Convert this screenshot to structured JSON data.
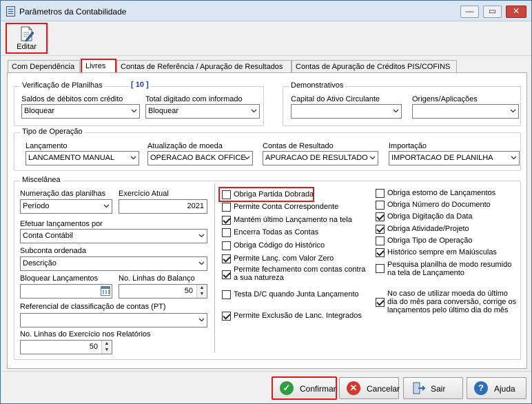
{
  "window": {
    "title": "Parâmetros da Contabilidade",
    "minimize": "—",
    "maximize": "▭",
    "close": "✕"
  },
  "toolbar": {
    "edit_label": "Editar"
  },
  "tabs": [
    "Com Dependência",
    "Livres",
    "Contas de Referência / Apuração de Resultados",
    "Contas de Apuração de Créditos PIS/COFINS"
  ],
  "verificacao": {
    "title": "Verificação de Planilhas",
    "count": "[ 10 ]",
    "saldos_label": "Saldos de débitos com crédito",
    "saldos_value": "Bloquear",
    "total_label": "Total digitado com informado",
    "total_value": "Bloquear"
  },
  "demonstrativos": {
    "title": "Demonstrativos",
    "capital_label": "Capital do Ativo Circulante",
    "capital_value": "",
    "origens_label": "Origens/Aplicações",
    "origens_value": ""
  },
  "tipo_operacao": {
    "title": "Tipo de Operação",
    "lancamento_label": "Lançamento",
    "lancamento_value": "LANCAMENTO MANUAL",
    "atualizacao_label": "Atualização de moeda",
    "atualizacao_value": "OPERACAO BACK OFFICE",
    "contas_label": "Contas de Resultado",
    "contas_value": "APURACAO DE RESULTADO",
    "importacao_label": "Importação",
    "importacao_value": "IMPORTACAO DE PLANILHA"
  },
  "miscelanea": {
    "title": "Miscelânea",
    "numeracao_label": "Numeração das planilhas",
    "numeracao_value": "Período",
    "exercicio_label": "Exercício Atual",
    "exercicio_value": "2021",
    "efetuar_label": "Efetuar lançamentos por",
    "efetuar_value": "Conta Contábil",
    "subconta_label": "Subconta ordenada",
    "subconta_value": "Descrição",
    "bloquear_label": "Bloquear Lançamentos",
    "bloquear_value": "",
    "linhas_balanco_label": "No. Linhas do Balanço",
    "linhas_balanco_value": "50",
    "referencial_label": "Referencial de classificação de contas (PT)",
    "referencial_value": "",
    "linhas_exercicio_label": "No. Linhas do Exercício nos Relatórios",
    "linhas_exercicio_value": "50"
  },
  "checks_mid": [
    {
      "label": "Obriga Partida Dobrada",
      "checked": false
    },
    {
      "label": "Permite Conta Correspondente",
      "checked": false
    },
    {
      "label": "Mantém último Lançamento na tela",
      "checked": true
    },
    {
      "label": "Encerra Todas as Contas",
      "checked": false
    },
    {
      "label": "Obriga Código do Histórico",
      "checked": false
    },
    {
      "label": "Permite Lanç. com Valor Zero",
      "checked": true
    },
    {
      "label": "Permite fechamento com contas contra a sua natureza",
      "checked": true
    },
    {
      "label": "Testa D/C quando Junta Lançamento",
      "checked": false
    },
    {
      "label": "Permite Exclusão de Lanc. Integrados",
      "checked": true
    }
  ],
  "checks_right": [
    {
      "label": "Obriga estorno de Lançamentos",
      "checked": false
    },
    {
      "label": "Obriga Número do Documento",
      "checked": false
    },
    {
      "label": "Obriga Digitação da Data",
      "checked": true
    },
    {
      "label": "Obriga Atividade/Projeto",
      "checked": true
    },
    {
      "label": "Obriga Tipo de Operação",
      "checked": false
    },
    {
      "label": "Histórico sempre em Maiúsculas",
      "checked": true
    },
    {
      "label": "Pesquisa planilha de modo resumido na tela de Lançamento",
      "checked": false
    },
    {
      "label": "No caso de utilizar moeda do último dia do mês para conversão, corrige os lançamentos pelo último dia do mês",
      "checked": true
    }
  ],
  "footer": {
    "confirmar": "Confirmar",
    "cancelar": "Cancelar",
    "sair": "Sair",
    "ajuda": "Ajuda"
  },
  "colors": {
    "highlight": "#e01b1b",
    "confirm_icon": "#2e9e3e",
    "cancel_icon": "#d2382c",
    "help_icon": "#2d6fb7",
    "count_text": "#1c3fb0"
  }
}
